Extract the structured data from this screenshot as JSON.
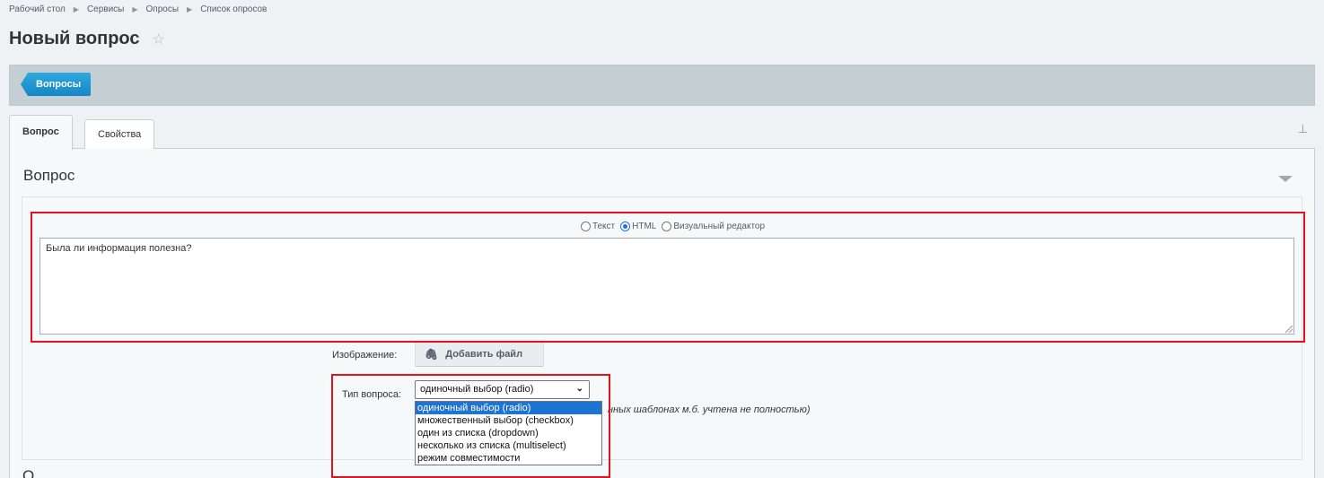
{
  "breadcrumb": [
    "Рабочий стол",
    "Сервисы",
    "Опросы",
    "Список опросов"
  ],
  "page_title": "Новый вопрос",
  "toolbar": {
    "back_label": "Вопросы"
  },
  "tabs": [
    {
      "label": "Вопрос",
      "active": true
    },
    {
      "label": "Свойства",
      "active": false
    }
  ],
  "section": {
    "title": "Вопрос",
    "text_modes": [
      "Текст",
      "HTML",
      "Визуальный редактор"
    ],
    "selected_mode": "HTML",
    "question_text": "Была ли информация полезна?",
    "image_label": "Изображение:",
    "add_file_label": "Добавить файл",
    "type_label": "Тип вопроса:",
    "type_value": "одиночный выбор (radio)",
    "type_options": [
      "одиночный выбор (radio)",
      "множественный выбор (checkbox)",
      "один из списка (dropdown)",
      "несколько из списка (multiselect)",
      "режим совместимости"
    ],
    "type_note": "нных шаблонах м.б. учтена не полностью)"
  },
  "next_section_partial": "О",
  "colors": {
    "accent": "#1d9ad6",
    "highlight": "#e8101a",
    "selected_option": "#1e74d3"
  }
}
